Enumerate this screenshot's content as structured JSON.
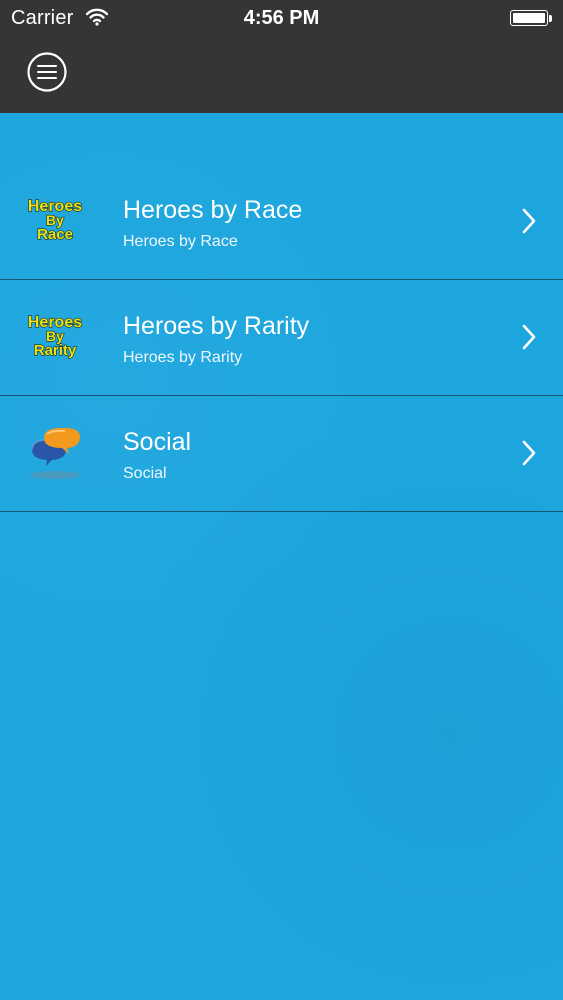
{
  "status_bar": {
    "carrier": "Carrier",
    "time": "4:56 PM",
    "wifi_icon": "wifi-icon",
    "battery_icon": "battery-icon"
  },
  "nav_bar": {
    "menu_icon": "hamburger-menu-icon",
    "background": "#353535"
  },
  "list": {
    "background": "#1da6de",
    "items": [
      {
        "title": "Heroes by Race",
        "subtitle": "Heroes by Race",
        "icon": "heroes-by-race-logo-icon",
        "icon_text": [
          "Heroes",
          "By",
          "Race"
        ]
      },
      {
        "title": "Heroes by Rarity",
        "subtitle": "Heroes by Rarity",
        "icon": "heroes-by-rarity-logo-icon",
        "icon_text": [
          "Heroes",
          "By",
          "Rarity"
        ]
      },
      {
        "title": "Social",
        "subtitle": "Social",
        "icon": "social-chat-bubbles-icon"
      }
    ]
  },
  "colors": {
    "logo_yellow": "#e9e21a",
    "chat_orange": "#f39a1e",
    "chat_blue": "#2a56a8"
  }
}
